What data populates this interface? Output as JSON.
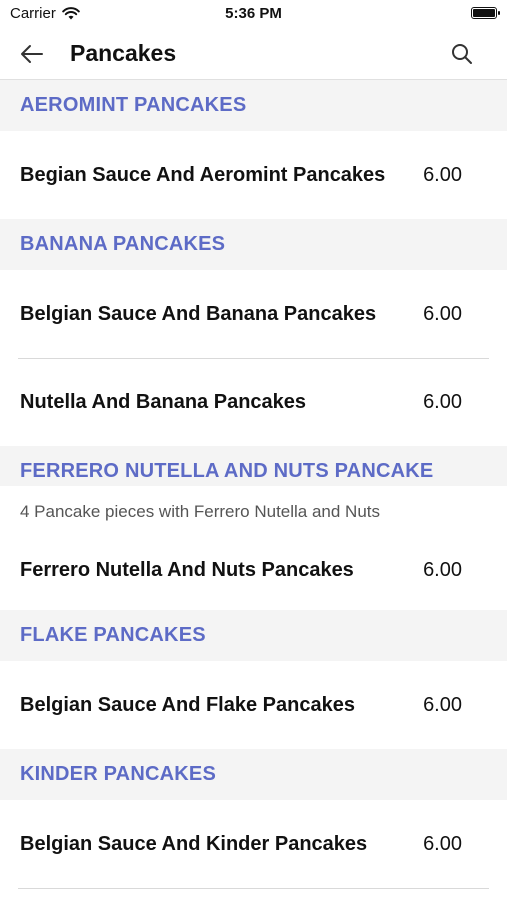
{
  "status": {
    "carrier": "Carrier",
    "time": "5:36 PM"
  },
  "header": {
    "title": "Pancakes"
  },
  "sections": [
    {
      "title": "AEROMINT PANCAKES",
      "items": [
        {
          "name": "Begian Sauce And Aeromint Pancakes",
          "price": "6.00"
        }
      ]
    },
    {
      "title": "BANANA PANCAKES",
      "items": [
        {
          "name": "Belgian Sauce And Banana Pancakes",
          "price": "6.00"
        },
        {
          "name": "Nutella And Banana Pancakes",
          "price": "6.00"
        }
      ]
    },
    {
      "title": "FERRERO NUTELLA AND NUTS PANCAKE",
      "description": "4 Pancake pieces with Ferrero Nutella and Nuts",
      "items": [
        {
          "name": "Ferrero Nutella And Nuts Pancakes",
          "price": "6.00"
        }
      ]
    },
    {
      "title": "FLAKE PANCAKES",
      "items": [
        {
          "name": "Belgian Sauce And Flake Pancakes",
          "price": "6.00"
        }
      ]
    },
    {
      "title": "KINDER PANCAKES",
      "items": [
        {
          "name": "Belgian Sauce And Kinder Pancakes",
          "price": "6.00"
        }
      ]
    }
  ]
}
